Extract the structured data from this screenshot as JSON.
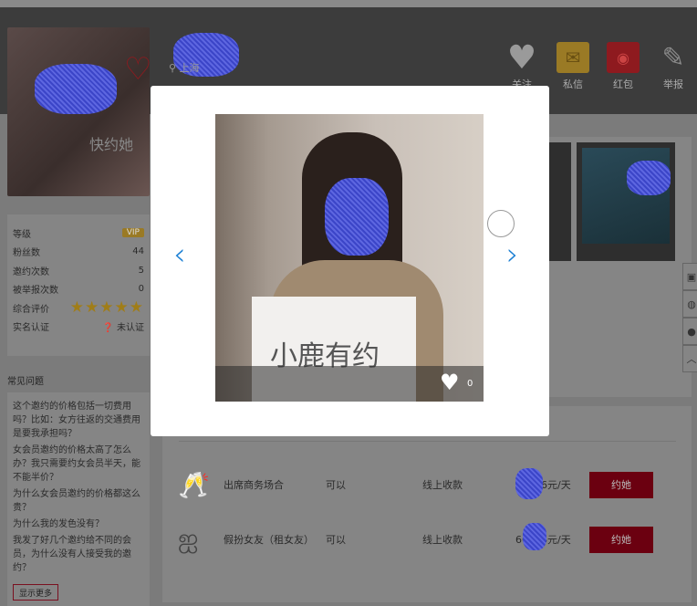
{
  "header": {
    "location": "上海",
    "actions": [
      {
        "label": "关注",
        "icon": "heart-icon",
        "color": "#9a9a9a"
      },
      {
        "label": "私信",
        "icon": "mail-icon",
        "color": "#9a7a25"
      },
      {
        "label": "红包",
        "icon": "red-envelope-icon",
        "color": "#8e1a1f"
      },
      {
        "label": "举报",
        "icon": "report-icon",
        "color": "#8a8a8a"
      }
    ]
  },
  "photo_watermark": "快约她",
  "stats": [
    {
      "label": "等级",
      "value": "VIP"
    },
    {
      "label": "粉丝数",
      "value": "44"
    },
    {
      "label": "邀约次数",
      "value": "5"
    },
    {
      "label": "被举报次数",
      "value": "0"
    },
    {
      "label": "综合评价",
      "rating": 5
    },
    {
      "label": "实名认证",
      "value": "未认证"
    }
  ],
  "faq": {
    "title": "常见问题",
    "items": [
      "这个邀约的价格包括一切费用吗？比如：女方往返的交通费用是要我承担吗？",
      "女会员邀约的价格太高了怎么办？我只需要约女会员半天，能不能半价？",
      "为什么女会员邀约的价格都这么贵？",
      "为什么我的发色没有？",
      "我发了好几个邀约给不同的会员，为什么没有人接受我的邀约？"
    ],
    "more": "显示更多"
  },
  "services": [
    {
      "name": "出席商务场合",
      "allowed": "可以",
      "payment": "线上收款",
      "price_a": "6",
      "price_b": "56元/天",
      "button": "约她",
      "icon": "wine-glasses-icon"
    },
    {
      "name": "假扮女友（租女友）",
      "allowed": "可以",
      "payment": "线上收款",
      "price_a": "66",
      "price_b": "6元/天",
      "button": "约她",
      "icon": "woman-hair-icon"
    }
  ],
  "modal": {
    "sign_text": "小鹿有约",
    "likes": "0",
    "prev": "‹",
    "next": "›"
  }
}
